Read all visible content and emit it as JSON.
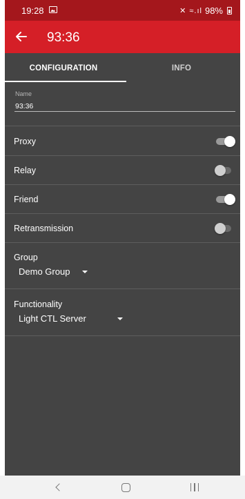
{
  "status_bar": {
    "time": "19:28",
    "image_icon": "image-notification-icon",
    "signal_text": "✕ ≈.ıl",
    "battery_text": "98%"
  },
  "app_bar": {
    "title": "93:36",
    "back_icon": "arrow-left-icon",
    "background_color": "#d51f27",
    "status_color": "#a4171c"
  },
  "tabs": [
    {
      "label": "CONFIGURATION",
      "selected": true
    },
    {
      "label": "INFO",
      "selected": false
    }
  ],
  "name_field": {
    "label": "Name",
    "value": "93:36"
  },
  "toggles": [
    {
      "label": "Proxy",
      "on": true
    },
    {
      "label": "Relay",
      "on": false
    },
    {
      "label": "Friend",
      "on": true
    },
    {
      "label": "Retransmission",
      "on": false
    }
  ],
  "group": {
    "label": "Group",
    "value": "Demo Group"
  },
  "functionality": {
    "label": "Functionality",
    "value": "Light CTL Server"
  },
  "nav_bar": {
    "back_icon": "chevron-left-icon",
    "home_icon": "home-icon",
    "recent_icon": "recent-apps-icon"
  }
}
